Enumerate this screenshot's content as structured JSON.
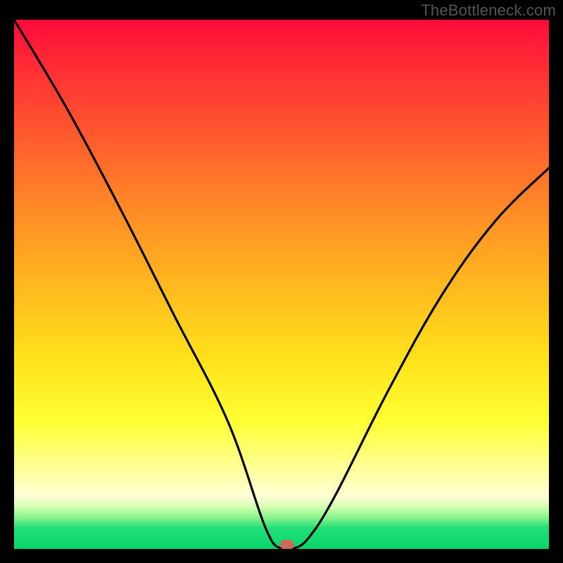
{
  "watermark": "TheBottleneck.com",
  "colors": {
    "frame": "#000000",
    "curve": "#000000",
    "marker": "#c96a5c"
  },
  "chart_data": {
    "type": "line",
    "title": "",
    "xlabel": "",
    "ylabel": "",
    "xlim": [
      0,
      100
    ],
    "ylim": [
      0,
      100
    ],
    "grid": false,
    "legend": false,
    "series": [
      {
        "name": "bottleneck-curve",
        "x": [
          0,
          10,
          20,
          30,
          40,
          47,
          50,
          52,
          55,
          60,
          70,
          80,
          90,
          100
        ],
        "y": [
          100,
          83,
          64,
          44,
          24,
          4,
          0,
          0,
          2,
          10,
          30,
          48,
          62,
          72
        ]
      }
    ],
    "marker": {
      "x": 51,
      "y": 0,
      "label": "optimal-point"
    },
    "gradient_stops": [
      {
        "pct": 0,
        "color": "#ff0b3a"
      },
      {
        "pct": 50,
        "color": "#ffb81f"
      },
      {
        "pct": 76,
        "color": "#ffff33"
      },
      {
        "pct": 96,
        "color": "#24e07a"
      },
      {
        "pct": 100,
        "color": "#07d66a"
      }
    ]
  }
}
